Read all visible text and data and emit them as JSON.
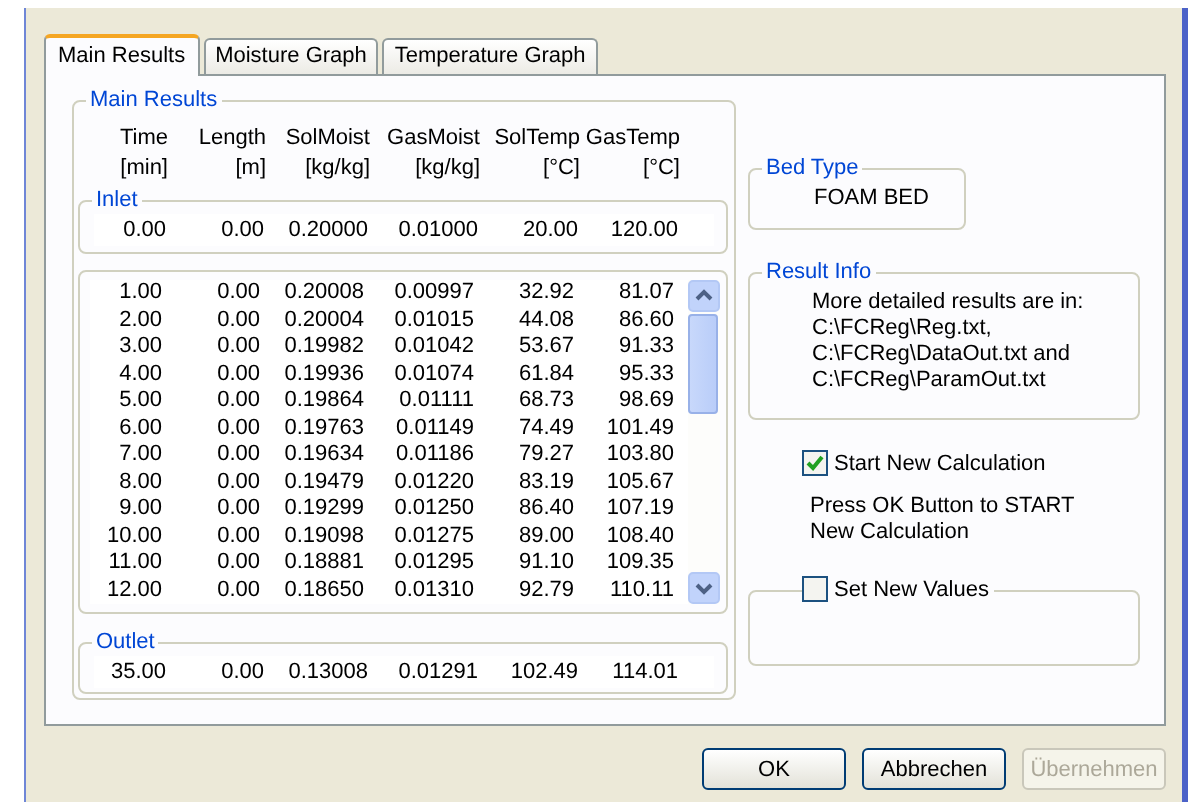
{
  "tabs": [
    {
      "label": "Main Results",
      "selected": true
    },
    {
      "label": "Moisture Graph",
      "selected": false
    },
    {
      "label": "Temperature Graph",
      "selected": false
    }
  ],
  "main_results": {
    "title": "Main Results",
    "columns": [
      {
        "name": "Time",
        "unit": "[min]"
      },
      {
        "name": "Length",
        "unit": "[m]"
      },
      {
        "name": "SolMoist",
        "unit": "[kg/kg]"
      },
      {
        "name": "GasMoist",
        "unit": "[kg/kg]"
      },
      {
        "name": "SolTemp",
        "unit": "[°C]"
      },
      {
        "name": "GasTemp",
        "unit": "[°C]"
      }
    ],
    "inlet": {
      "title": "Inlet",
      "values": [
        "0.00",
        "0.00",
        "0.20000",
        "0.01000",
        "20.00",
        "120.00"
      ]
    },
    "rows": [
      [
        "1.00",
        "0.00",
        "0.20008",
        "0.00997",
        "32.92",
        "81.07"
      ],
      [
        "2.00",
        "0.00",
        "0.20004",
        "0.01015",
        "44.08",
        "86.60"
      ],
      [
        "3.00",
        "0.00",
        "0.19982",
        "0.01042",
        "53.67",
        "91.33"
      ],
      [
        "4.00",
        "0.00",
        "0.19936",
        "0.01074",
        "61.84",
        "95.33"
      ],
      [
        "5.00",
        "0.00",
        "0.19864",
        "0.01111",
        "68.73",
        "98.69"
      ],
      [
        "6.00",
        "0.00",
        "0.19763",
        "0.01149",
        "74.49",
        "101.49"
      ],
      [
        "7.00",
        "0.00",
        "0.19634",
        "0.01186",
        "79.27",
        "103.80"
      ],
      [
        "8.00",
        "0.00",
        "0.19479",
        "0.01220",
        "83.19",
        "105.67"
      ],
      [
        "9.00",
        "0.00",
        "0.19299",
        "0.01250",
        "86.40",
        "107.19"
      ],
      [
        "10.00",
        "0.00",
        "0.19098",
        "0.01275",
        "89.00",
        "108.40"
      ],
      [
        "11.00",
        "0.00",
        "0.18881",
        "0.01295",
        "91.10",
        "109.35"
      ],
      [
        "12.00",
        "0.00",
        "0.18650",
        "0.01310",
        "92.79",
        "110.11"
      ]
    ],
    "outlet": {
      "title": "Outlet",
      "values": [
        "35.00",
        "0.00",
        "0.13008",
        "0.01291",
        "102.49",
        "114.01"
      ]
    }
  },
  "bed_type": {
    "title": "Bed Type",
    "value": "FOAM BED"
  },
  "result_info": {
    "title": "Result Info",
    "lines": [
      "More detailed results are in:",
      "C:\\FCReg\\Reg.txt,",
      "C:\\FCReg\\DataOut.txt and",
      "C:\\FCReg\\ParamOut.txt"
    ]
  },
  "start_new_calculation": {
    "label": "Start New Calculation",
    "checked": true
  },
  "note": "Press OK Button to START New Calculation",
  "set_new_values": {
    "label": "Set New Values",
    "checked": false
  },
  "buttons": [
    {
      "label": "OK",
      "disabled": false
    },
    {
      "label": "Abbrechen",
      "disabled": false
    },
    {
      "label": "Übernehmen",
      "disabled": true
    }
  ]
}
